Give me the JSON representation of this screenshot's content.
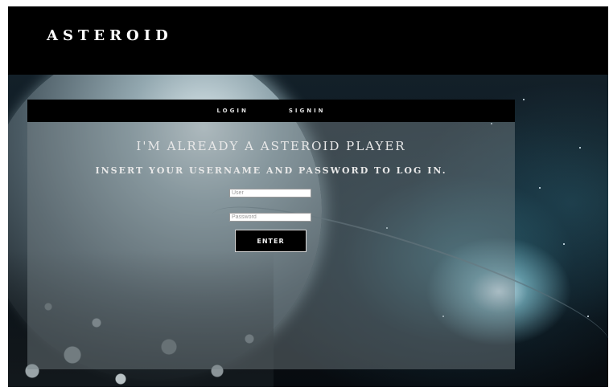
{
  "header": {
    "brand": "ASTEROID"
  },
  "tabs": [
    {
      "label": "LOGIN"
    },
    {
      "label": "SIGNIN"
    }
  ],
  "login": {
    "title": "I'M ALREADY A ASTEROID PLAYER",
    "subtitle": "INSERT YOUR USERNAME AND PASSWORD TO LOG IN.",
    "user_placeholder": "User",
    "password_placeholder": "Password",
    "enter_label": "ENTER"
  },
  "colors": {
    "header_bg": "#000000",
    "panel_bg": "rgba(120,130,135,0.45)",
    "text": "#e8e8e8"
  }
}
